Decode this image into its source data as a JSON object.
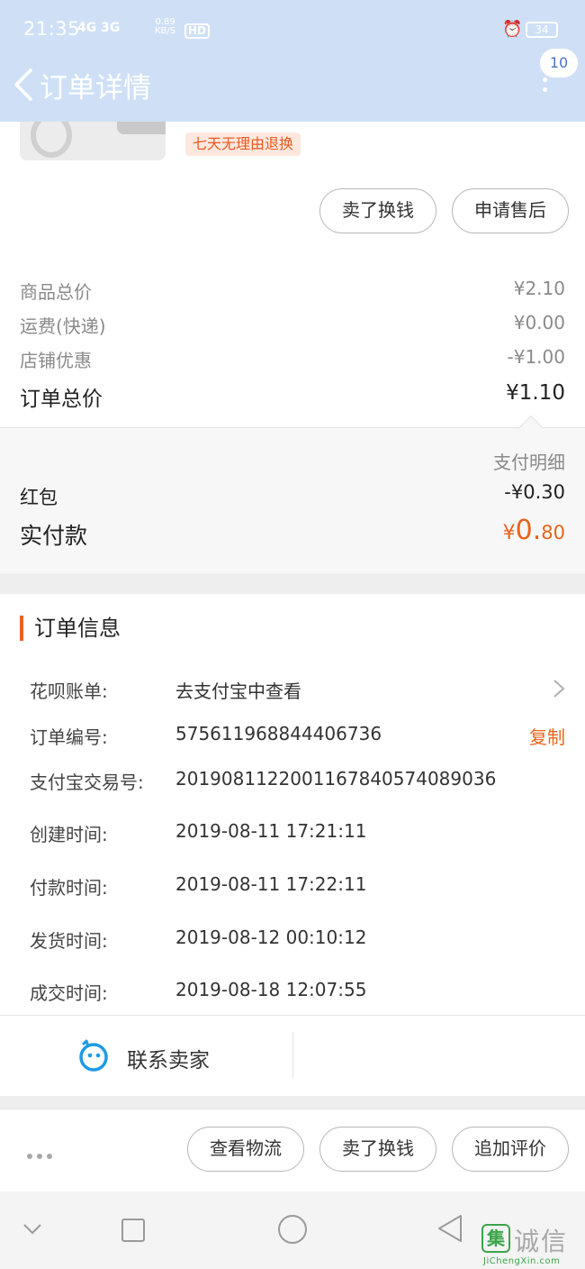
{
  "status_bar": {
    "time": "21:35",
    "signal": "4G 3G",
    "net_speed": "0.89",
    "net_speed_unit": "KB/S",
    "hd": "HD",
    "battery": "34"
  },
  "header": {
    "title": "订单详情",
    "badge_count": "10"
  },
  "product": {
    "return_tag": "七天无理由退换",
    "buttons": {
      "sell": "卖了换钱",
      "after_sale": "申请售后"
    }
  },
  "price": {
    "goods_label": "商品总价",
    "goods_value": "¥2.10",
    "shipping_label": "运费(快递)",
    "shipping_value": "¥0.00",
    "discount_label": "店铺优惠",
    "discount_value": "-¥1.00",
    "total_label": "订单总价",
    "total_value": "¥1.10"
  },
  "payment": {
    "detail_link": "支付明细",
    "redpacket_label": "红包",
    "redpacket_value": "-¥0.30",
    "paid_label": "实付款",
    "paid_currency": "¥",
    "paid_int": "0.",
    "paid_dec": "80"
  },
  "order_info": {
    "title": "订单信息",
    "rows": [
      {
        "key": "花呗账单:",
        "value": "去支付宝中查看"
      },
      {
        "key": "订单编号:",
        "value": "575611968844406736",
        "action": "复制"
      },
      {
        "key": "支付宝交易号:",
        "value": "2019081122001167840574089036"
      },
      {
        "key": "创建时间:",
        "value": "2019-08-11 17:21:11"
      },
      {
        "key": "付款时间:",
        "value": "2019-08-11 17:22:11"
      },
      {
        "key": "发货时间:",
        "value": "2019-08-12 00:10:12"
      },
      {
        "key": "成交时间:",
        "value": "2019-08-18 12:07:55"
      }
    ]
  },
  "contact": {
    "label": "联系卖家"
  },
  "bottom_actions": {
    "logistics": "查看物流",
    "sell": "卖了换钱",
    "review": "追加评价"
  },
  "watermark": {
    "logo_char": "集",
    "name": "诚信",
    "url": "JiChengXin.com"
  },
  "colors": {
    "accent": "#e8641d",
    "header": "#cfe0f6",
    "contact_icon": "#1d9be4"
  }
}
